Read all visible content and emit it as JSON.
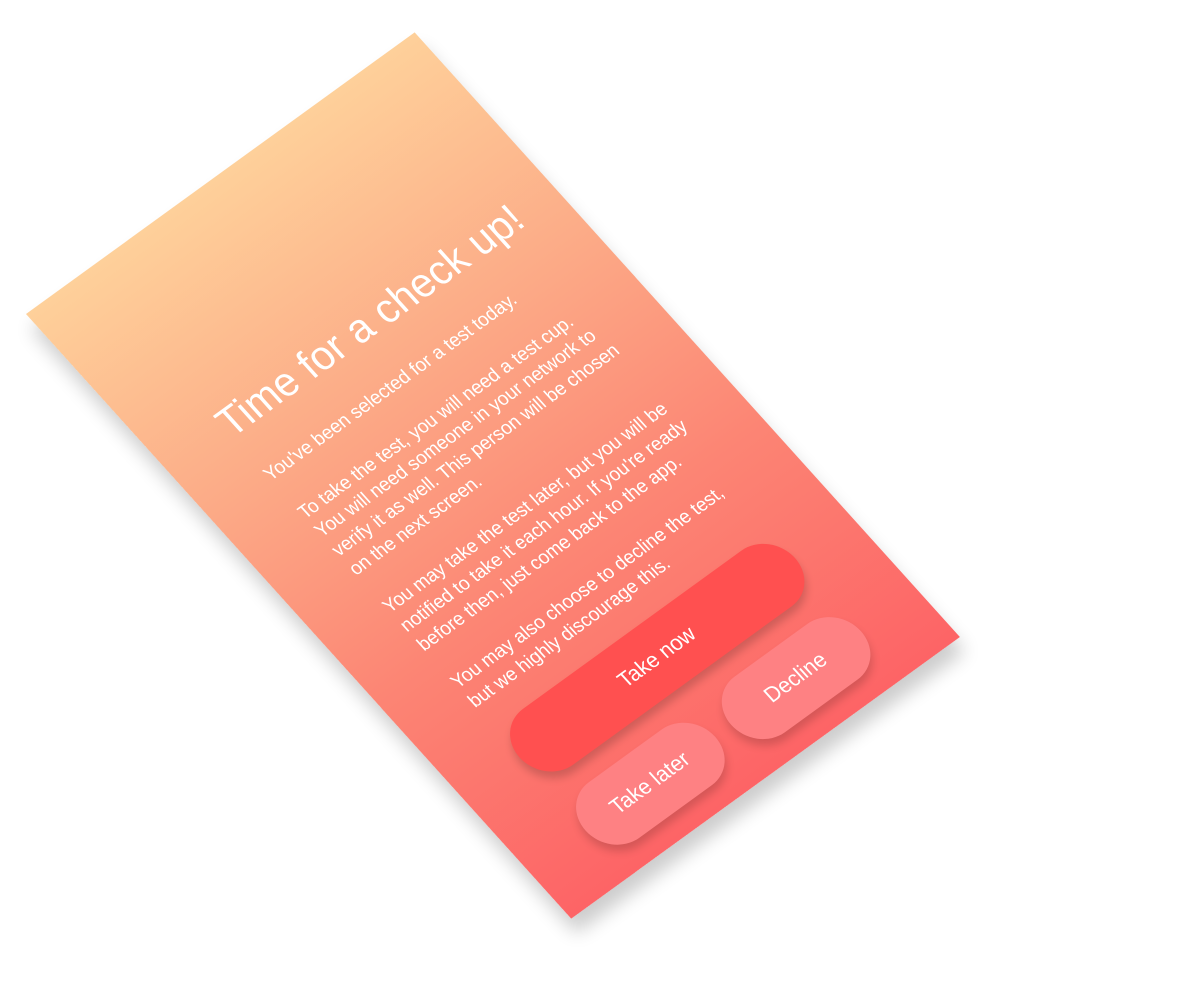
{
  "screen": {
    "title": "Time for a check up!",
    "paragraphs": [
      "You've been selected for a test today.",
      "To take the test, you will need a test cup. You will need someone in your network to verify it as well. This person will be chosen on the next screen.",
      "You may take the test later, but you will be notified to take it each hour. If you're ready before then, just come back to the app.",
      "You may also choose to decline the test, but we highly discourage this."
    ]
  },
  "actions": {
    "take_now": "Take now",
    "take_later": "Take later",
    "decline": "Decline"
  },
  "colors": {
    "gradient_top": "#fed09a",
    "gradient_bottom": "#fd6466",
    "primary_button": "#ff5050",
    "secondary_button": "#fe8183",
    "text": "#ffffff"
  }
}
